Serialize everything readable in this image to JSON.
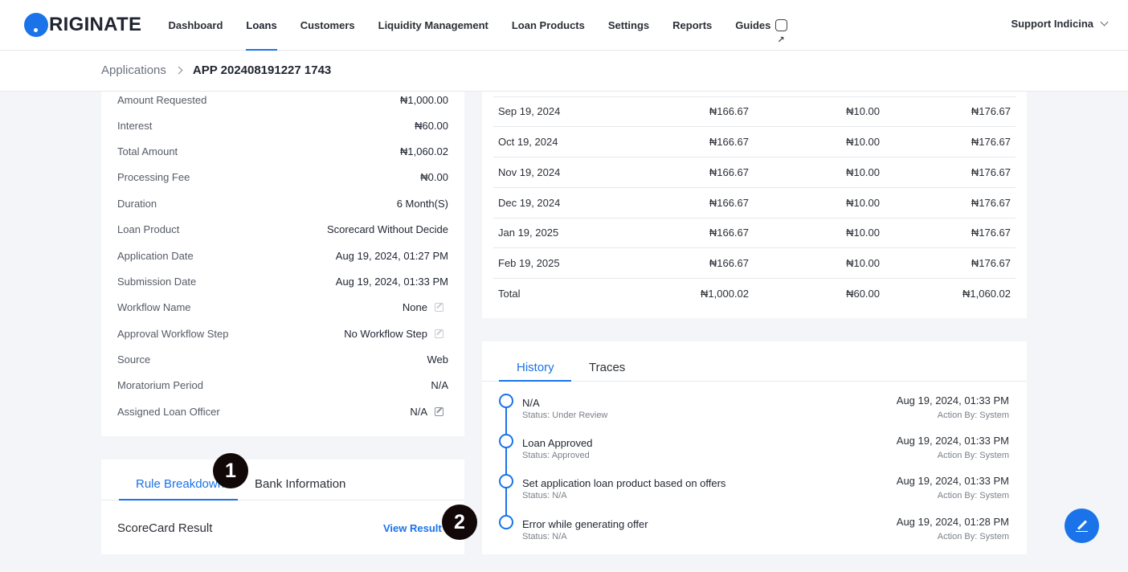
{
  "app": {
    "logo_text": "RIGINATE",
    "brand_color": "#1a73e8"
  },
  "nav": {
    "items": [
      "Dashboard",
      "Loans",
      "Customers",
      "Liquidity Management",
      "Loan Products",
      "Settings",
      "Reports",
      "Guides"
    ],
    "active": "Loans",
    "user": "Support Indicina"
  },
  "breadcrumb": {
    "parent": "Applications",
    "current": "APP 202408191227 1743"
  },
  "details": [
    {
      "label": "Amount Requested",
      "value": "₦1,000.00"
    },
    {
      "label": "Interest",
      "value": "₦60.00"
    },
    {
      "label": "Total Amount",
      "value": "₦1,060.02"
    },
    {
      "label": "Processing Fee",
      "value": "₦0.00"
    },
    {
      "label": "Duration",
      "value": "6 Month(S)"
    },
    {
      "label": "Loan Product",
      "value": "Scorecard Without Decide"
    },
    {
      "label": "Application Date",
      "value": "Aug 19, 2024, 01:27 PM"
    },
    {
      "label": "Submission Date",
      "value": "Aug 19, 2024, 01:33 PM"
    },
    {
      "label": "Workflow Name",
      "value": "None"
    },
    {
      "label": "Approval Workflow Step",
      "value": "No Workflow Step"
    },
    {
      "label": "Source",
      "value": "Web"
    },
    {
      "label": "Moratorium Period",
      "value": "N/A"
    },
    {
      "label": "Assigned Loan Officer",
      "value": "N/A"
    }
  ],
  "rules": {
    "tabs": [
      "Rule Breakdown",
      "Bank Information"
    ],
    "active_tab": "Rule Breakdown",
    "row_label": "ScoreCard Result",
    "action": "View Result"
  },
  "markers": [
    "1",
    "2"
  ],
  "schedule": {
    "rows": [
      [
        "Sep 19, 2024",
        "₦166.67",
        "₦10.00",
        "₦176.67"
      ],
      [
        "Oct 19, 2024",
        "₦166.67",
        "₦10.00",
        "₦176.67"
      ],
      [
        "Nov 19, 2024",
        "₦166.67",
        "₦10.00",
        "₦176.67"
      ],
      [
        "Dec 19, 2024",
        "₦166.67",
        "₦10.00",
        "₦176.67"
      ],
      [
        "Jan 19, 2025",
        "₦166.67",
        "₦10.00",
        "₦176.67"
      ],
      [
        "Feb 19, 2025",
        "₦166.67",
        "₦10.00",
        "₦176.67"
      ]
    ],
    "total": [
      "Total",
      "₦1,000.02",
      "₦60.00",
      "₦1,060.02"
    ]
  },
  "history": {
    "tabs": [
      "History",
      "Traces"
    ],
    "active_tab": "History",
    "events": [
      {
        "title": "N/A",
        "status": "Status: Under Review",
        "date": "Aug 19, 2024, 01:33 PM",
        "by": "Action By: System"
      },
      {
        "title": "Loan Approved",
        "status": "Status: Approved",
        "date": "Aug 19, 2024, 01:33 PM",
        "by": "Action By: System"
      },
      {
        "title": "Set application loan product based on offers",
        "status": "Status: N/A",
        "date": "Aug 19, 2024, 01:33 PM",
        "by": "Action By: System"
      },
      {
        "title": "Error while generating offer",
        "status": "Status: N/A",
        "date": "Aug 19, 2024, 01:28 PM",
        "by": "Action By: System"
      }
    ]
  },
  "fab_icon": "edit-pen-icon"
}
